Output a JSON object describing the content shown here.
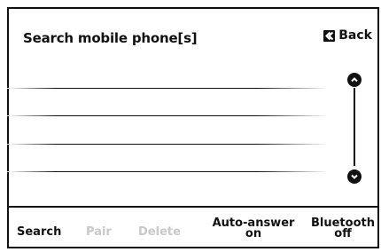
{
  "header": {
    "title": "Search mobile phone[s]",
    "back_label": "Back"
  },
  "list": {
    "rows": [
      "",
      "",
      "",
      ""
    ]
  },
  "toolbar": {
    "items": [
      {
        "label": "Search",
        "state": "enabled"
      },
      {
        "label": "Pair",
        "state": "disabled"
      },
      {
        "label": "Delete",
        "state": "disabled"
      },
      {
        "label_line1": "Auto-answer",
        "label_line2": "on",
        "state": "enabled"
      },
      {
        "label_line1": "Bluetooth",
        "label_line2": "off",
        "state": "enabled"
      }
    ]
  },
  "icons": {
    "back": "back-arrow-icon",
    "scroll_up": "scroll-up-chevron-icon",
    "scroll_down": "scroll-down-chevron-icon"
  },
  "colors": {
    "foreground": "#111111",
    "disabled_text": "#c9c9c9",
    "background": "#ffffff"
  }
}
